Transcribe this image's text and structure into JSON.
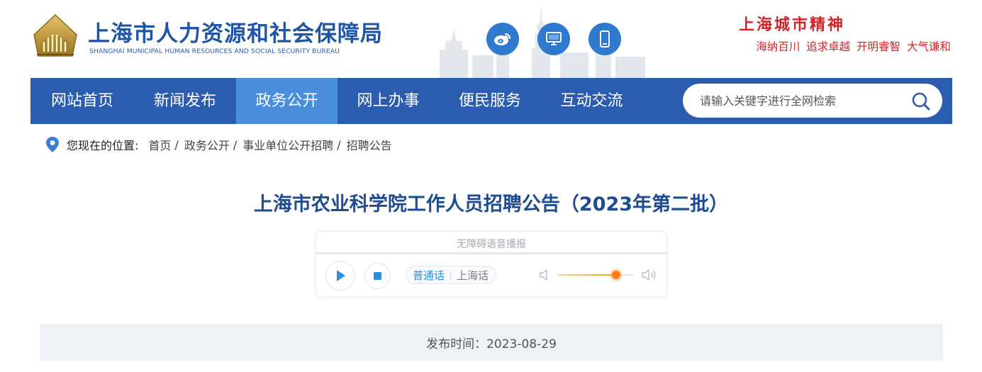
{
  "header": {
    "org_name_cn": "上海市人力资源和社会保障局",
    "org_name_en": "SHANGHAI MUNICIPAL HUMAN RESOURCES AND SOCIAL SECURITY BUREAU",
    "social_icons": [
      "weibo-icon",
      "desktop-icon",
      "mobile-icon"
    ],
    "slogan_title": "上海城市精神",
    "slogan_sub": "海纳百川 追求卓越 开明睿智 大气谦和"
  },
  "nav": {
    "items": [
      {
        "label": "网站首页"
      },
      {
        "label": "新闻发布"
      },
      {
        "label": "政务公开",
        "active": true
      },
      {
        "label": "网上办事"
      },
      {
        "label": "便民服务"
      },
      {
        "label": "互动交流"
      }
    ],
    "search_placeholder": "请输入关键字进行全网检索"
  },
  "breadcrumb": {
    "label": "您现在的位置:",
    "items": [
      "首页",
      "政务公开",
      "事业单位公开招聘",
      "招聘公告"
    ],
    "separator": "/"
  },
  "article": {
    "title": "上海市农业科学院工作人员招聘公告（2023年第二批）",
    "publish_label": "发布时间：",
    "publish_date": "2023-08-29",
    "meta_text": "发布时间：2023-08-29"
  },
  "player": {
    "caption": "无障碍语音播报",
    "languages": [
      "普通话",
      "上海话"
    ],
    "active_language": "普通话",
    "progress": 0.0,
    "volume": 0.77
  },
  "colors": {
    "brand_blue": "#1f55a7",
    "nav_bg": "#2a5db0",
    "nav_active": "#4a8ede",
    "slogan_red": "#d2232a",
    "accent_orange": "#ff7b16"
  }
}
